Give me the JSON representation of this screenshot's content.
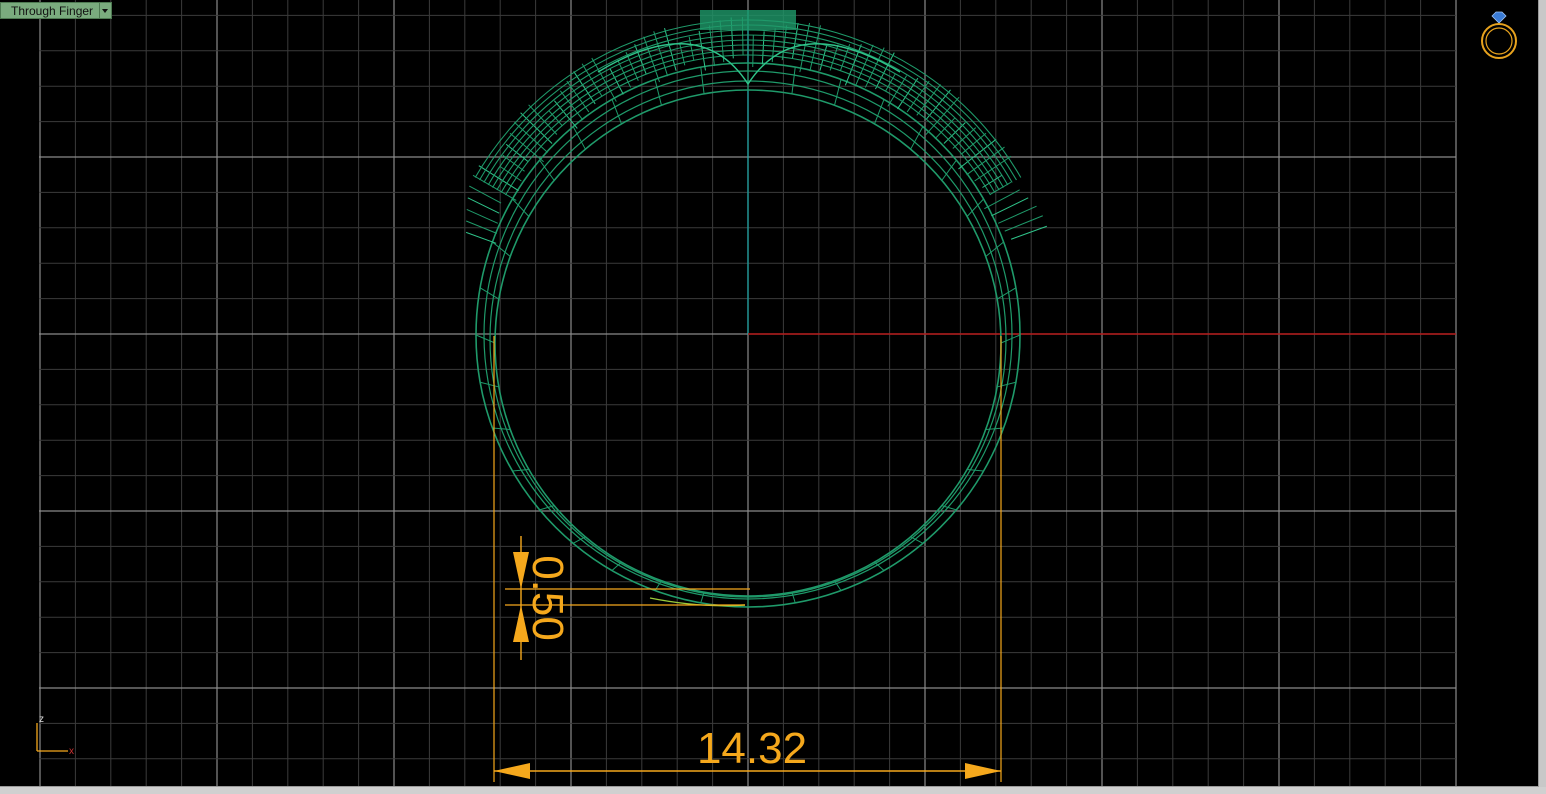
{
  "viewport": {
    "view_name": "Through Finger",
    "background": "#000000"
  },
  "colors": {
    "grid_minor": "#3b3b3b",
    "grid_major": "#8a8a8a",
    "ring": "#1f9a6a",
    "ring_bright": "#2fc48a",
    "x_axis": "#b01515",
    "z_axis": "#1aa7a7",
    "dimension": "#f5a81c"
  },
  "dimensions": {
    "width_label": "14.32",
    "thickness_label": "0.50"
  },
  "axis_widget": {
    "z_label": "z",
    "x_label": "x"
  },
  "icons": {
    "ring_icon": "ring-with-gem-icon",
    "dropdown": "chevron-down-icon"
  }
}
